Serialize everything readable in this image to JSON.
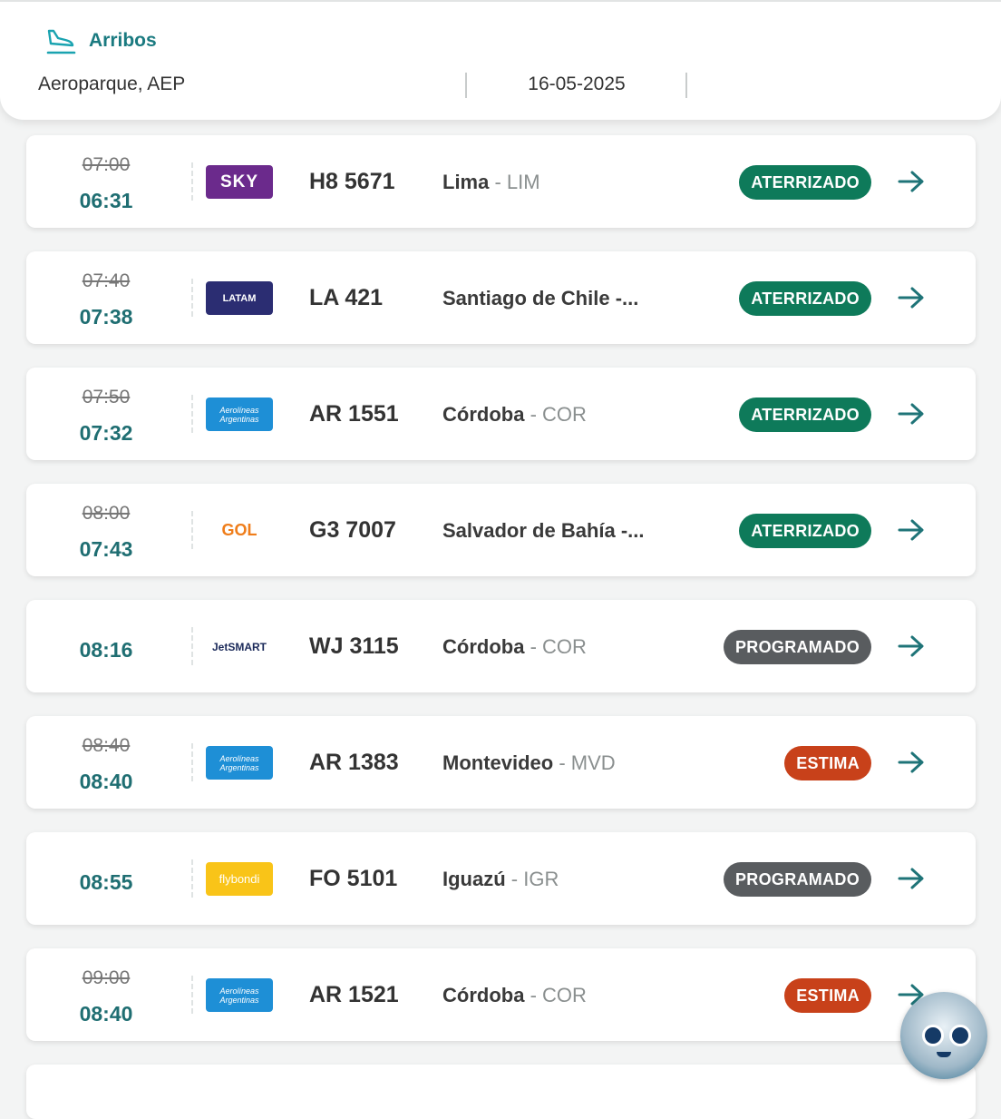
{
  "header": {
    "title": "Arribos",
    "airport": "Aeroparque, AEP",
    "date": "16-05-2025",
    "accent_color": "#1a7a80",
    "icon": "plane-landing-icon"
  },
  "status_colors": {
    "ATERRIZADO": "#0e7a5a",
    "PROGRAMADO": "#595c5f",
    "ESTIMA": "#c8411a"
  },
  "flights": [
    {
      "scheduled": "07:00",
      "actual": "06:31",
      "airline_logo": "SKY",
      "flight": "H8 5671",
      "city": "Lima",
      "code": " - LIM",
      "status": "ATERRIZADO"
    },
    {
      "scheduled": "07:40",
      "actual": "07:38",
      "airline_logo": "LATAM",
      "flight": "LA 421",
      "city": "Santiago de Chile -...",
      "code": "",
      "status": "ATERRIZADO"
    },
    {
      "scheduled": "07:50",
      "actual": "07:32",
      "airline_logo": "Aerolíneas Argentinas",
      "flight": "AR 1551",
      "city": "Córdoba",
      "code": " - COR",
      "status": "ATERRIZADO"
    },
    {
      "scheduled": "08:00",
      "actual": "07:43",
      "airline_logo": "GOL",
      "flight": "G3 7007",
      "city": "Salvador de Bahía -...",
      "code": "",
      "status": "ATERRIZADO"
    },
    {
      "scheduled": "",
      "actual": "08:16",
      "airline_logo": "JetSMART",
      "flight": "WJ 3115",
      "city": "Córdoba",
      "code": " - COR",
      "status": "PROGRAMADO"
    },
    {
      "scheduled": "08:40",
      "actual": "08:40",
      "airline_logo": "Aerolíneas Argentinas",
      "flight": "AR 1383",
      "city": "Montevideo",
      "code": " - MVD",
      "status": "ESTIMA"
    },
    {
      "scheduled": "",
      "actual": "08:55",
      "airline_logo": "flybondi",
      "flight": "FO 5101",
      "city": "Iguazú",
      "code": " - IGR",
      "status": "PROGRAMADO"
    },
    {
      "scheduled": "09:00",
      "actual": "08:40",
      "airline_logo": "Aerolíneas Argentinas",
      "flight": "AR 1521",
      "city": "Córdoba",
      "code": " - COR",
      "status": "ESTIMA"
    }
  ],
  "assistant": {
    "icon": "chat-assistant-robot-icon"
  }
}
